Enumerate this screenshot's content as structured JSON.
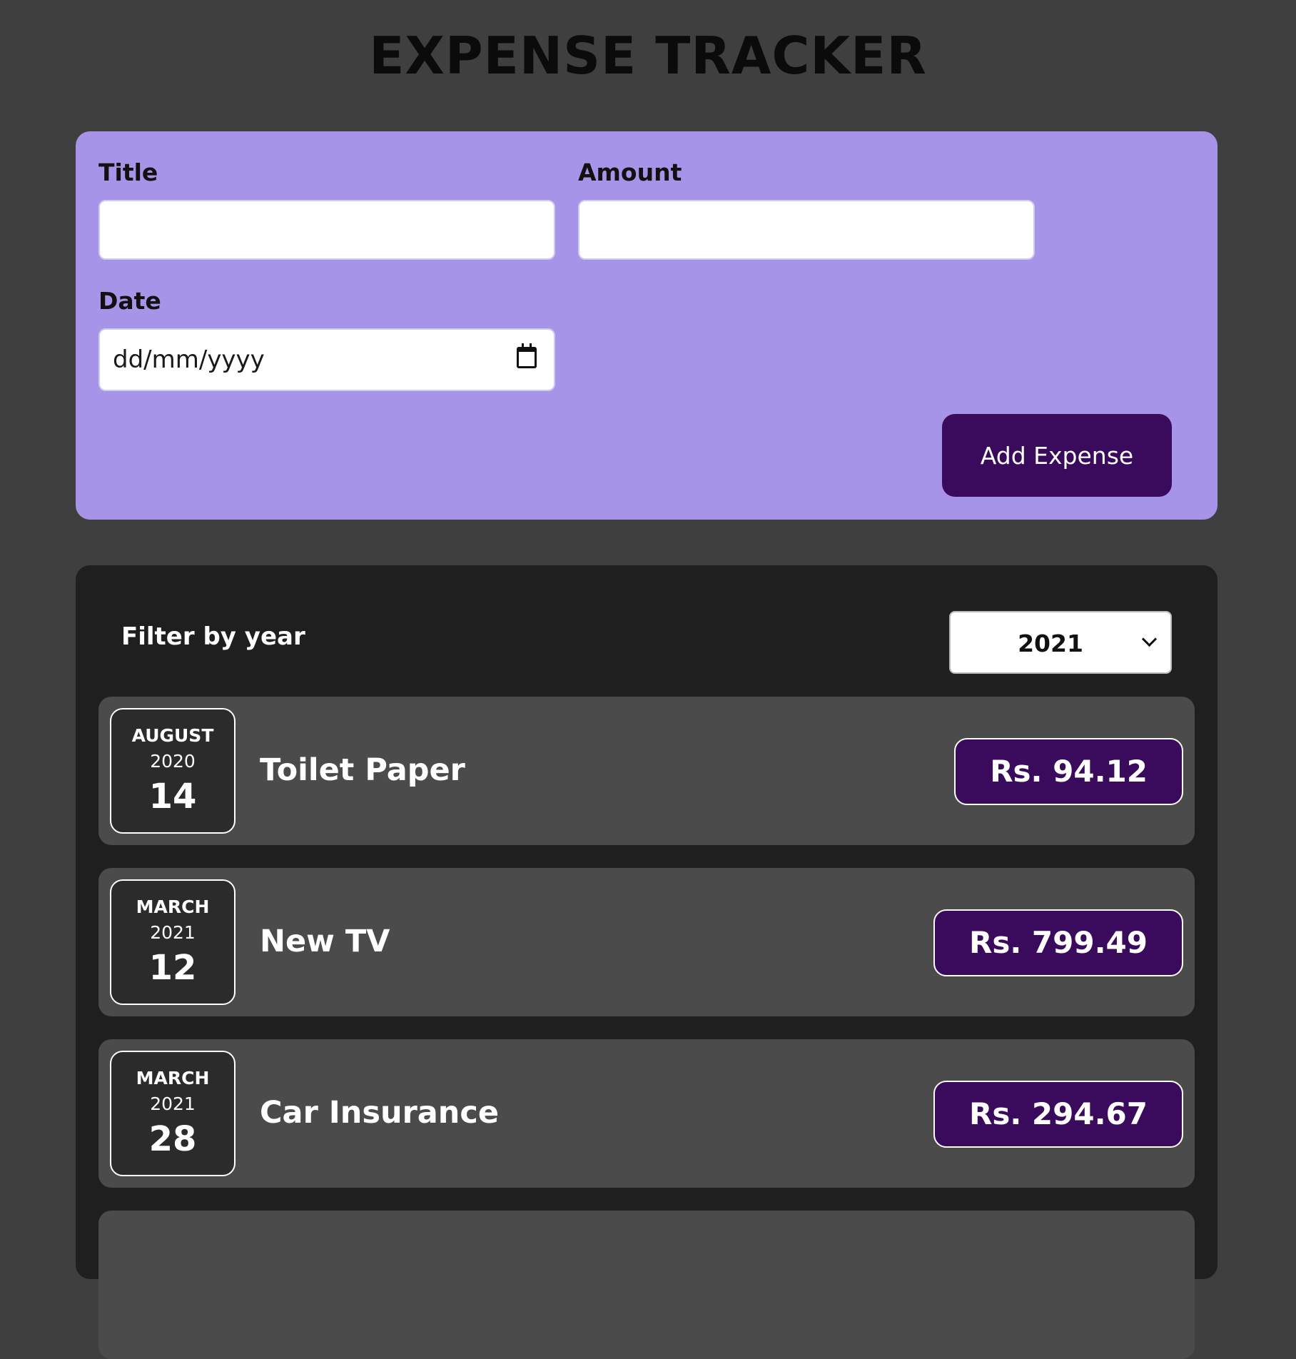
{
  "header": {
    "title": "EXPENSE TRACKER"
  },
  "form": {
    "title_label": "Title",
    "title_value": "",
    "amount_label": "Amount",
    "amount_value": "",
    "date_label": "Date",
    "date_placeholder": "dd/mm/yyyy",
    "submit_label": "Add Expense"
  },
  "filter": {
    "label": "Filter by year",
    "selected_year": "2021"
  },
  "expenses": [
    {
      "month": "AUGUST",
      "year": "2020",
      "day": "14",
      "title": "Toilet Paper",
      "amount": "Rs. 94.12"
    },
    {
      "month": "MARCH",
      "year": "2021",
      "day": "12",
      "title": "New TV",
      "amount": "Rs. 799.49"
    },
    {
      "month": "MARCH",
      "year": "2021",
      "day": "28",
      "title": "Car Insurance",
      "amount": "Rs. 294.67"
    }
  ],
  "colors": {
    "page_background": "#3f3f3f",
    "form_background": "#a594e8",
    "accent_purple": "#3a0a5c",
    "list_background": "#1f1f1f",
    "item_background": "#4b4b4b"
  }
}
